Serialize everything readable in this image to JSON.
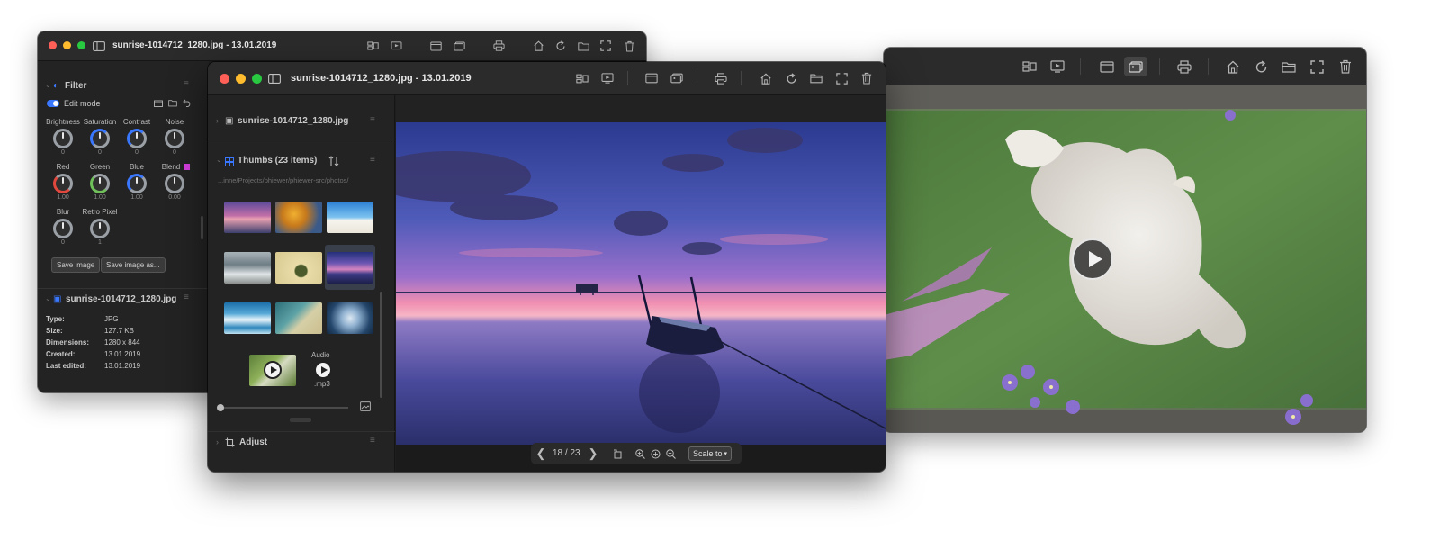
{
  "back_window": {
    "title": "sunrise-1014712_1280.jpg - 13.01.2019",
    "filter": {
      "header": "Filter",
      "edit_mode": "Edit mode",
      "knobs_row1": [
        {
          "label": "Brightness",
          "value": "0"
        },
        {
          "label": "Saturation",
          "value": "0"
        },
        {
          "label": "Contrast",
          "value": "0"
        },
        {
          "label": "Noise",
          "value": "0"
        }
      ],
      "knobs_row2": [
        {
          "label": "Red",
          "value": "1.00"
        },
        {
          "label": "Green",
          "value": "1.00"
        },
        {
          "label": "Blue",
          "value": "1.00"
        },
        {
          "label": "Blend",
          "value": "0.00"
        }
      ],
      "knobs_row3": [
        {
          "label": "Blur",
          "value": "0"
        },
        {
          "label": "Retro Pixel",
          "value": "1"
        }
      ],
      "save_image": "Save image",
      "save_image_as": "Save image as..."
    },
    "info": {
      "header": "sunrise-1014712_1280.jpg",
      "rows": [
        {
          "key": "Type:",
          "value": "JPG"
        },
        {
          "key": "Size:",
          "value": "127.7 KB"
        },
        {
          "key": "Dimensions:",
          "value": "1280 x 844"
        },
        {
          "key": "Created:",
          "value": "13.01.2019"
        },
        {
          "key": "Last edited:",
          "value": "13.01.2019"
        }
      ]
    }
  },
  "front_window": {
    "title": "sunrise-1014712_1280.jpg - 13.01.2019",
    "file_section": "sunrise-1014712_1280.jpg",
    "thumbs_header": "Thumbs (23 items)",
    "thumbs_path": "...inne/Projects/phiewer/phiewer-src/photos/",
    "audio_label": "Audio",
    "audio_ext": ".mp3",
    "adjust_header": "Adjust",
    "page_indicator": "18 / 23",
    "scale_select": "Scale to"
  },
  "colors": {
    "window_bg": "#1e1e1e",
    "titlebar_bg": "#2b2b2b",
    "accent_blue": "#3a77ff",
    "blend_swatch": "#d63fe0"
  }
}
